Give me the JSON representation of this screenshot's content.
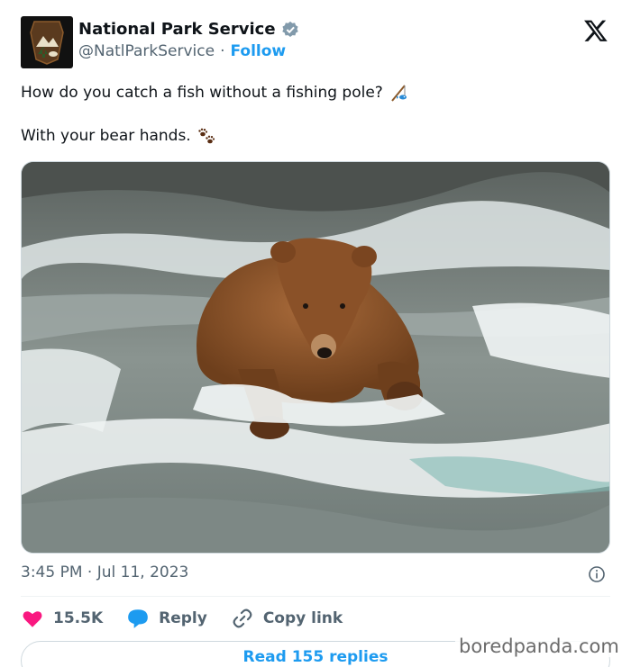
{
  "author": {
    "display_name": "National Park Service",
    "handle": "@NatlParkService",
    "separator": "·",
    "follow_label": "Follow"
  },
  "tweet": {
    "line1": "How do you catch a fish without a fishing pole?",
    "line2": "With your bear hands."
  },
  "meta": {
    "timestamp": "3:45 PM · Jul 11, 2023"
  },
  "actions": {
    "likes": "15.5K",
    "reply_label": "Reply",
    "copy_label": "Copy link"
  },
  "replies_button": "Read 155 replies",
  "watermark": "boredpanda.com",
  "colors": {
    "accent": "#1d9bf0",
    "like": "#f91880",
    "muted": "#536471"
  }
}
